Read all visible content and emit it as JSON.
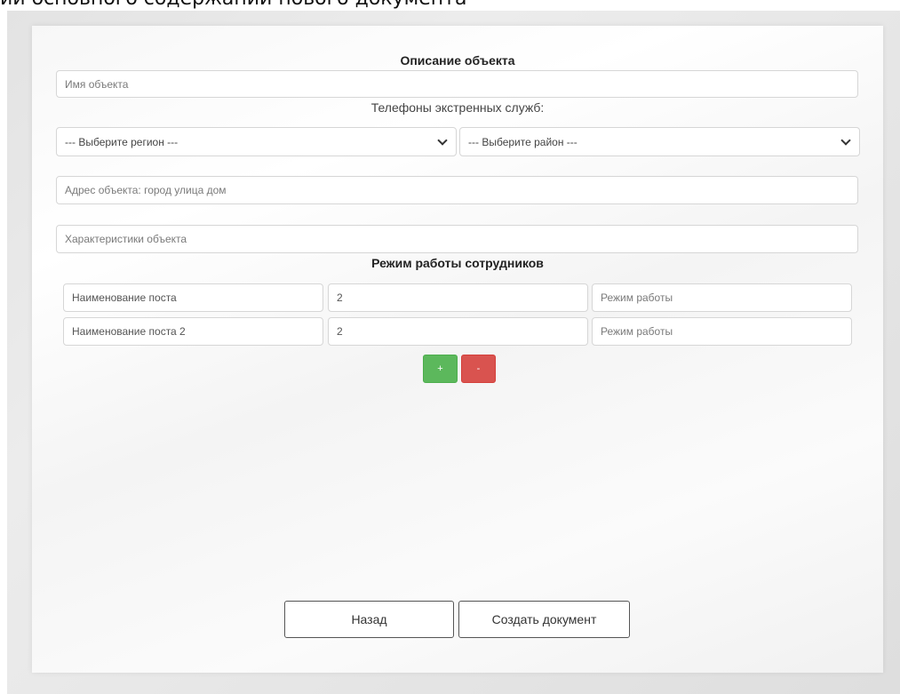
{
  "caption": "ии основного содержании нового документа",
  "form": {
    "title": "Описание объекта",
    "name_placeholder": "Имя объекта",
    "emergency_label": "Телефоны экстренных служб:",
    "region_select": "--- Выберите регион ---",
    "district_select": "--- Выберите район ---",
    "address_placeholder": "Адрес объекта: город улица дом",
    "characteristics_placeholder": "Характеристики объекта",
    "schedule_title": "Режим работы сотрудников",
    "posts": [
      {
        "name": "Наименование поста",
        "count": "2",
        "mode_placeholder": "Режим работы"
      },
      {
        "name": "Наименование поста 2",
        "count": "2",
        "mode_placeholder": "Режим работы"
      }
    ],
    "add_label": "+",
    "remove_label": "-",
    "back_label": "Назад",
    "create_label": "Создать документ"
  },
  "colors": {
    "add": "#5cb85c",
    "remove": "#d9534f"
  }
}
